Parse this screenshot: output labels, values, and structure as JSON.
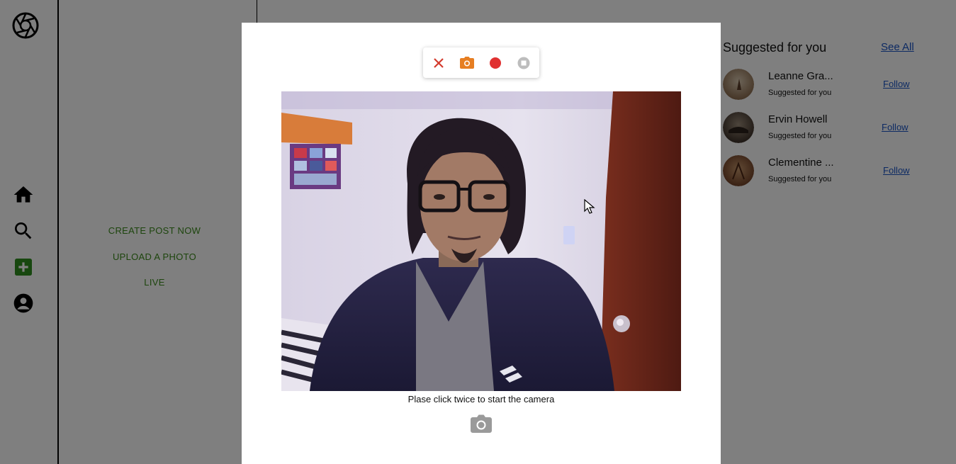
{
  "create_menu": {
    "create_post": "CREATE POST NOW",
    "upload_photo": "UPLOAD A PHOTO",
    "live": "LIVE"
  },
  "suggestions": {
    "title": "Suggested for you",
    "see_all": "See All",
    "items": [
      {
        "name": "Leanne Gra...",
        "subtitle": "Suggested for you",
        "action": "Follow"
      },
      {
        "name": "Ervin Howell",
        "subtitle": "Suggested for you",
        "action": "Follow"
      },
      {
        "name": "Clementine ...",
        "subtitle": "Suggested for you",
        "action": "Follow"
      }
    ]
  },
  "camera_modal": {
    "toolbar": {
      "close_icon": "close-icon",
      "photo_icon": "camera-icon",
      "record_icon": "record-icon",
      "stop_icon": "stop-icon"
    },
    "hint": "Plase click twice to start the camera"
  },
  "colors": {
    "accent_green": "#3b8a1a",
    "link_blue": "#1a55c6",
    "close_red": "#d33a2c",
    "photo_orange": "#e67e22",
    "record_red": "#e03131",
    "stop_grey": "#bdbdbd"
  }
}
